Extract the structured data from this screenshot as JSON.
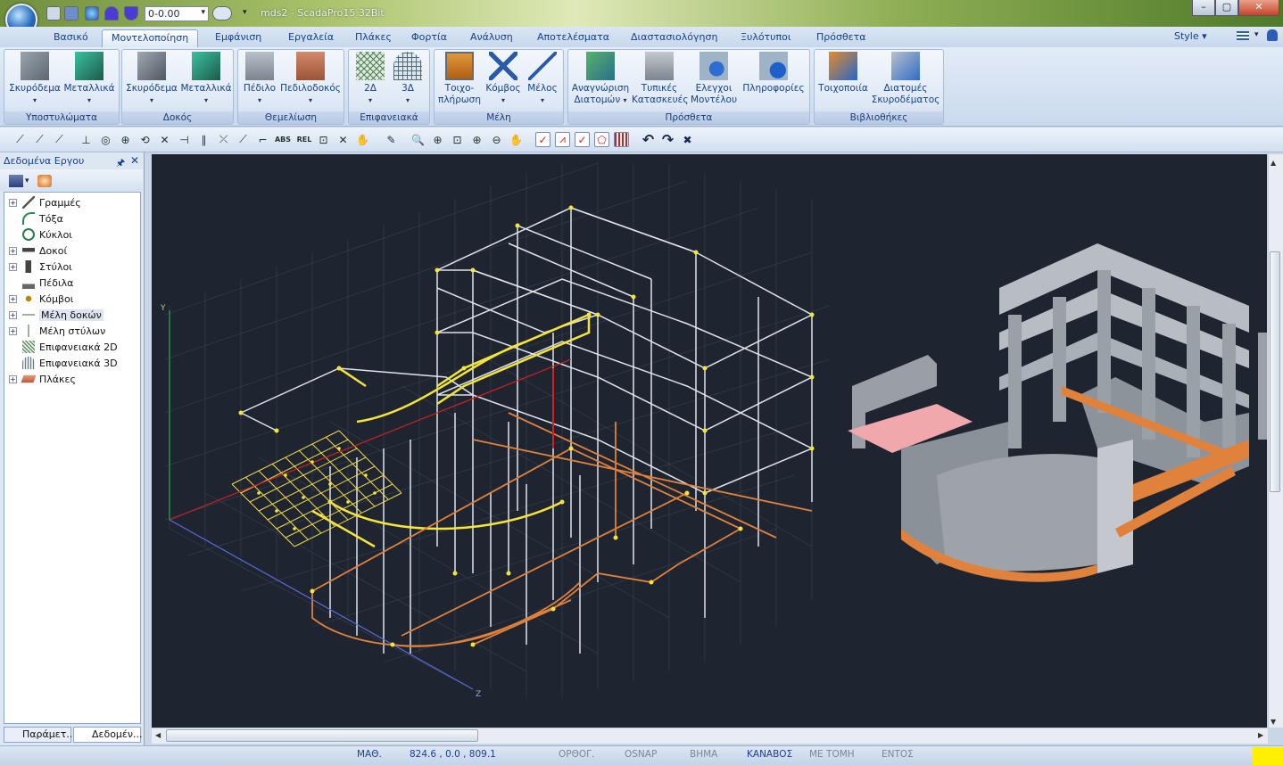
{
  "window": {
    "title": "mds2 - ScadaPro15 32Bit",
    "layer_value": "0-0.00",
    "minimize": "–",
    "maximize": "▢",
    "close": "✕"
  },
  "tabs": [
    "Βασικό",
    "Μοντελοποίηση",
    "Εμφάνιση",
    "Εργαλεία",
    "Πλάκες",
    "Φορτία",
    "Ανάλυση",
    "Αποτελέσματα",
    "Διαστασιολόγηση",
    "Ξυλότυποι",
    "Πρόσθετα"
  ],
  "style_label": "Style",
  "groups": {
    "columns": {
      "caption": "Υποστυλώματα",
      "b1": "Σκυρόδεμα",
      "b2": "Μεταλλικά"
    },
    "beams": {
      "caption": "Δοκός",
      "b1": "Σκυρόδεμα",
      "b2": "Μεταλλικά"
    },
    "foundation": {
      "caption": "Θεμελίωση",
      "b1": "Πέδιλο",
      "b2": "Πεδιλοδοκός"
    },
    "surfaces": {
      "caption": "Επιφανειακά",
      "b1": "2Δ",
      "b2": "3Δ"
    },
    "members": {
      "caption": "Μέλη",
      "b1": "Τοιχο-πλήρωση",
      "b2": "Κόμβος",
      "b3": "Μέλος"
    },
    "extras": {
      "caption": "Πρόσθετα",
      "b1": "Αναγνώριση Διατομών",
      "b2": "Τυπικές Κατασκευές",
      "b3": "Ελεγχοι Μοντέλου",
      "b4": "Πληροφορίες"
    },
    "libraries": {
      "caption": "Βιβλιοθήκες",
      "b1": "Τοιχοποιία",
      "b2": "Διατομές Σκυροδέματος"
    }
  },
  "toolbar_labels": {
    "abs": "ABS",
    "rel": "REL"
  },
  "panel": {
    "title": "Δεδομένα Εργου",
    "items": [
      "Γραμμές",
      "Τόξα",
      "Κύκλοι",
      "Δοκοί",
      "Στύλοι",
      "Πέδιλα",
      "Κόμβοι",
      "Μέλη δοκών",
      "Μέλη στύλων",
      "Επιφανειακά 2D",
      "Επιφανειακά 3D",
      "Πλάκες"
    ],
    "tab1": "Παράμετ...",
    "tab2": "Δεδομέν..."
  },
  "viewport": {
    "axis_y": "Y",
    "axis_z": "Z"
  },
  "status": {
    "math": "ΜΑΘ.",
    "coords": "824.6 , 0.0 , 809.1",
    "ortho": "ΟΡΘΟΓ.",
    "osnap": "OSNAP",
    "step": "ΒΗΜΑ",
    "grid": "ΚΑΝΑΒΟΣ",
    "section": "ΜΕ ΤΟΜΗ",
    "within": "ΕΝΤΟΣ"
  },
  "colors": {
    "viewport_bg": "#1f2530",
    "highlight_yellow": "#f5e53a",
    "orange": "#e0813c",
    "red_axis": "#d32020",
    "accent": "#15428b"
  }
}
